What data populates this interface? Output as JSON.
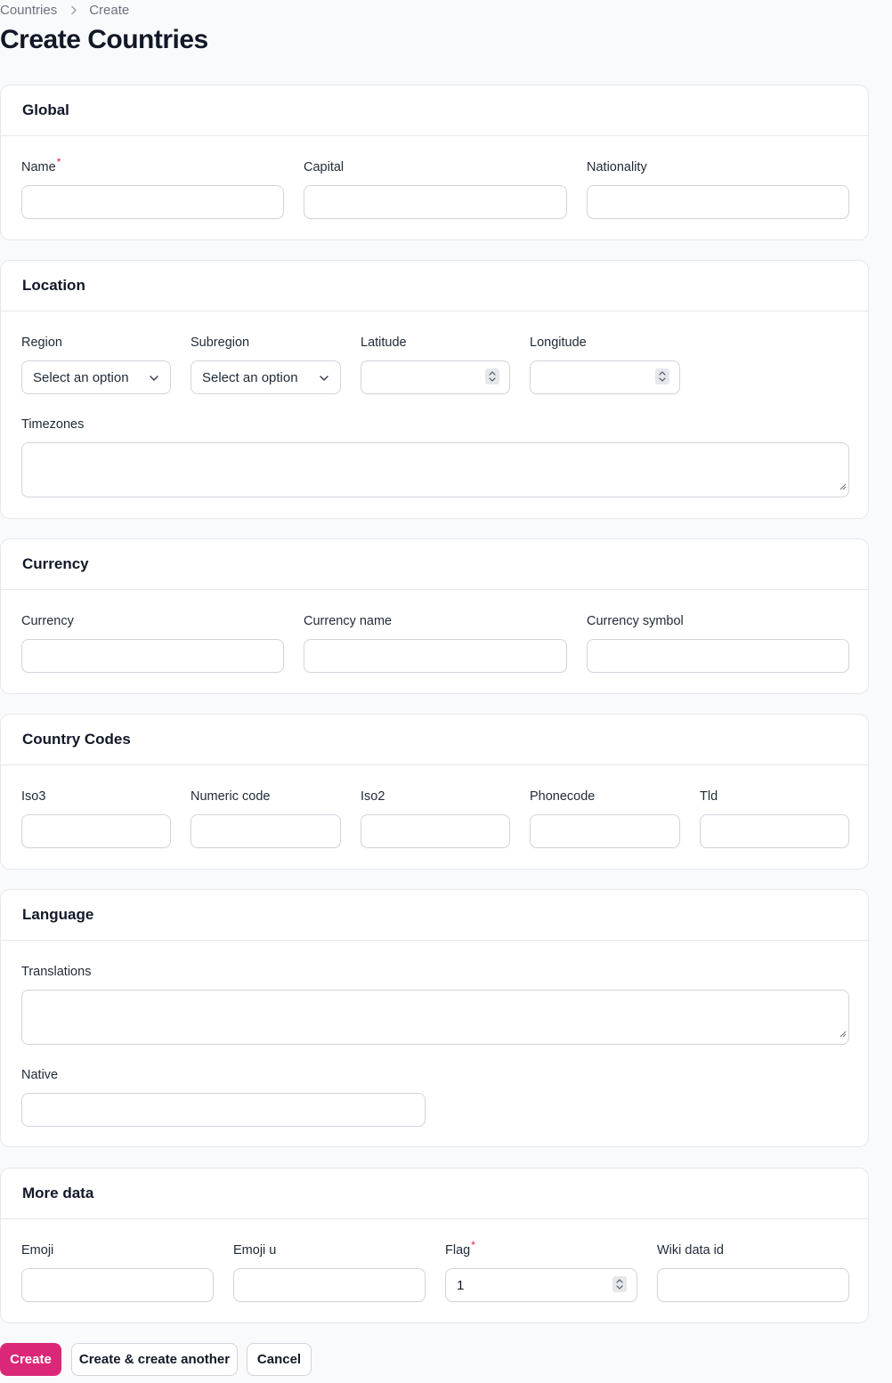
{
  "breadcrumb": {
    "parent": "Countries",
    "current": "Create"
  },
  "page": {
    "title": "Create Countries"
  },
  "colors": {
    "primary": "#db2777",
    "required": "#e11d48"
  },
  "sections": {
    "global": {
      "title": "Global",
      "name": {
        "label": "Name",
        "required": "*",
        "value": ""
      },
      "capital": {
        "label": "Capital",
        "value": ""
      },
      "nationality": {
        "label": "Nationality",
        "value": ""
      }
    },
    "location": {
      "title": "Location",
      "region": {
        "label": "Region",
        "value": "Select an option"
      },
      "subregion": {
        "label": "Subregion",
        "value": "Select an option"
      },
      "latitude": {
        "label": "Latitude",
        "value": ""
      },
      "longitude": {
        "label": "Longitude",
        "value": ""
      },
      "timezones": {
        "label": "Timezones",
        "value": ""
      }
    },
    "currency": {
      "title": "Currency",
      "currency": {
        "label": "Currency",
        "value": ""
      },
      "currency_name": {
        "label": "Currency name",
        "value": ""
      },
      "currency_symbol": {
        "label": "Currency symbol",
        "value": ""
      }
    },
    "country_codes": {
      "title": "Country Codes",
      "iso3": {
        "label": "Iso3",
        "value": ""
      },
      "numeric_code": {
        "label": "Numeric code",
        "value": ""
      },
      "iso2": {
        "label": "Iso2",
        "value": ""
      },
      "phonecode": {
        "label": "Phonecode",
        "value": ""
      },
      "tld": {
        "label": "Tld",
        "value": ""
      }
    },
    "language": {
      "title": "Language",
      "translations": {
        "label": "Translations",
        "value": ""
      },
      "native": {
        "label": "Native",
        "value": ""
      }
    },
    "more_data": {
      "title": "More data",
      "emoji": {
        "label": "Emoji",
        "value": ""
      },
      "emoji_u": {
        "label": "Emoji u",
        "value": ""
      },
      "flag": {
        "label": "Flag",
        "required": "*",
        "value": "1"
      },
      "wiki_data_id": {
        "label": "Wiki data id",
        "value": ""
      }
    }
  },
  "actions": {
    "create": "Create",
    "create_another": "Create & create another",
    "cancel": "Cancel"
  }
}
